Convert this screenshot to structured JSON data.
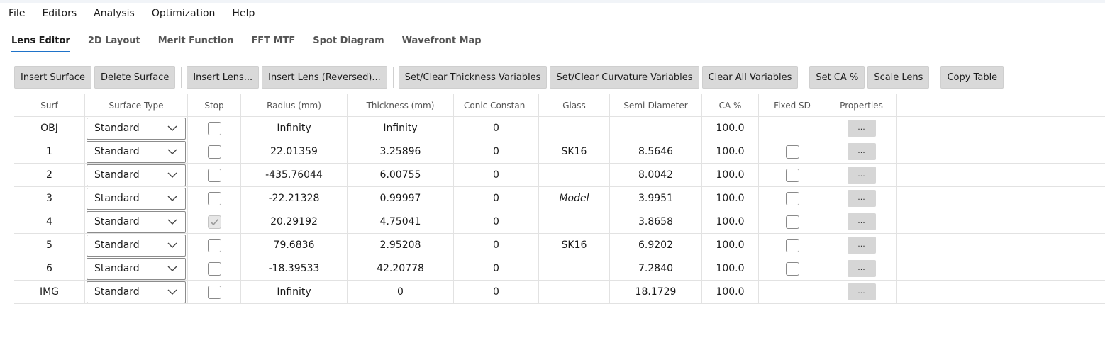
{
  "menu": [
    "File",
    "Editors",
    "Analysis",
    "Optimization",
    "Help"
  ],
  "tabs": [
    {
      "label": "Lens Editor",
      "active": true
    },
    {
      "label": "2D Layout",
      "active": false
    },
    {
      "label": "Merit Function",
      "active": false
    },
    {
      "label": "FFT MTF",
      "active": false
    },
    {
      "label": "Spot Diagram",
      "active": false
    },
    {
      "label": "Wavefront Map",
      "active": false
    }
  ],
  "toolbar": {
    "insert_surface": "Insert Surface",
    "delete_surface": "Delete Surface",
    "insert_lens": "Insert Lens...",
    "insert_lens_reversed": "Insert Lens (Reversed)...",
    "set_clear_thickness": "Set/Clear Thickness Variables",
    "set_clear_curvature": "Set/Clear Curvature Variables",
    "clear_all_variables": "Clear All Variables",
    "set_ca": "Set CA %",
    "scale_lens": "Scale Lens",
    "copy_table": "Copy Table"
  },
  "table": {
    "headers": {
      "surf": "Surf",
      "surface_type": "Surface Type",
      "stop": "Stop",
      "radius": "Radius (mm)",
      "thickness": "Thickness (mm)",
      "conic": "Conic Constan",
      "glass": "Glass",
      "semi_diameter": "Semi-Diameter",
      "ca": "CA %",
      "fixed_sd": "Fixed SD",
      "properties": "Properties"
    },
    "rows": [
      {
        "surf": "OBJ",
        "type": "Standard",
        "stop": false,
        "radius": "Infinity",
        "thickness": "Infinity",
        "conic": "0",
        "glass": "",
        "glass_italic": false,
        "sd": "",
        "ca": "100.0",
        "fixed_sd": null,
        "prop": "..."
      },
      {
        "surf": "1",
        "type": "Standard",
        "stop": false,
        "radius": "22.01359",
        "thickness": "3.25896",
        "conic": "0",
        "glass": "SK16",
        "glass_italic": false,
        "sd": "8.5646",
        "ca": "100.0",
        "fixed_sd": false,
        "prop": "..."
      },
      {
        "surf": "2",
        "type": "Standard",
        "stop": false,
        "radius": "-435.76044",
        "thickness": "6.00755",
        "conic": "0",
        "glass": "",
        "glass_italic": false,
        "sd": "8.0042",
        "ca": "100.0",
        "fixed_sd": false,
        "prop": "..."
      },
      {
        "surf": "3",
        "type": "Standard",
        "stop": false,
        "radius": "-22.21328",
        "thickness": "0.99997",
        "conic": "0",
        "glass": "Model",
        "glass_italic": true,
        "sd": "3.9951",
        "ca": "100.0",
        "fixed_sd": false,
        "prop": "..."
      },
      {
        "surf": "4",
        "type": "Standard",
        "stop": true,
        "radius": "20.29192",
        "thickness": "4.75041",
        "conic": "0",
        "glass": "",
        "glass_italic": false,
        "sd": "3.8658",
        "ca": "100.0",
        "fixed_sd": false,
        "prop": "..."
      },
      {
        "surf": "5",
        "type": "Standard",
        "stop": false,
        "radius": "79.6836",
        "thickness": "2.95208",
        "conic": "0",
        "glass": "SK16",
        "glass_italic": false,
        "sd": "6.9202",
        "ca": "100.0",
        "fixed_sd": false,
        "prop": "..."
      },
      {
        "surf": "6",
        "type": "Standard",
        "stop": false,
        "radius": "-18.39533",
        "thickness": "42.20778",
        "conic": "0",
        "glass": "",
        "glass_italic": false,
        "sd": "7.2840",
        "ca": "100.0",
        "fixed_sd": false,
        "prop": "..."
      },
      {
        "surf": "IMG",
        "type": "Standard",
        "stop": false,
        "radius": "Infinity",
        "thickness": "0",
        "conic": "0",
        "glass": "",
        "glass_italic": false,
        "sd": "18.1729",
        "ca": "100.0",
        "fixed_sd": null,
        "prop": "..."
      }
    ]
  },
  "colors": {
    "accent": "#1f73c9",
    "button_bg": "#d9d9d9"
  }
}
